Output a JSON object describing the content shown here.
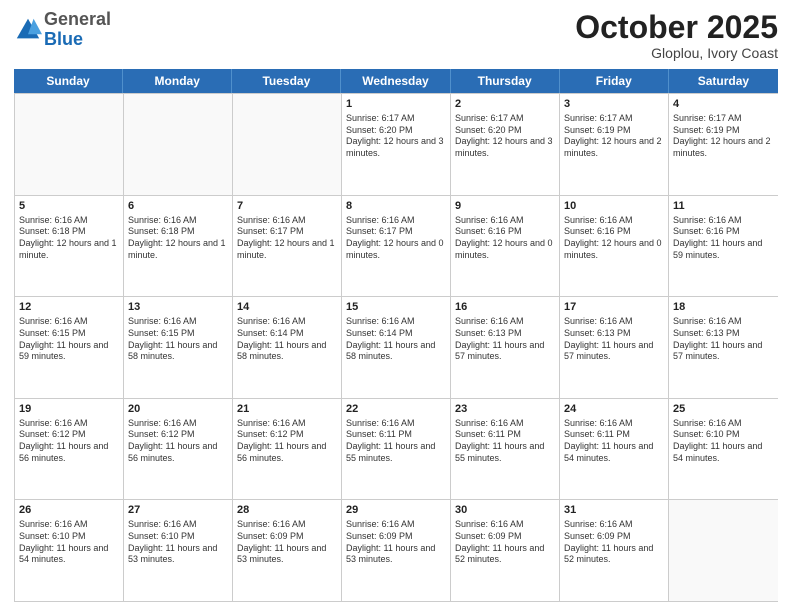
{
  "header": {
    "logo_general": "General",
    "logo_blue": "Blue",
    "month_title": "October 2025",
    "location": "Gloplou, Ivory Coast"
  },
  "days_of_week": [
    "Sunday",
    "Monday",
    "Tuesday",
    "Wednesday",
    "Thursday",
    "Friday",
    "Saturday"
  ],
  "weeks": [
    [
      {
        "day": "",
        "info": ""
      },
      {
        "day": "",
        "info": ""
      },
      {
        "day": "",
        "info": ""
      },
      {
        "day": "1",
        "info": "Sunrise: 6:17 AM\nSunset: 6:20 PM\nDaylight: 12 hours and 3 minutes."
      },
      {
        "day": "2",
        "info": "Sunrise: 6:17 AM\nSunset: 6:20 PM\nDaylight: 12 hours and 3 minutes."
      },
      {
        "day": "3",
        "info": "Sunrise: 6:17 AM\nSunset: 6:19 PM\nDaylight: 12 hours and 2 minutes."
      },
      {
        "day": "4",
        "info": "Sunrise: 6:17 AM\nSunset: 6:19 PM\nDaylight: 12 hours and 2 minutes."
      }
    ],
    [
      {
        "day": "5",
        "info": "Sunrise: 6:16 AM\nSunset: 6:18 PM\nDaylight: 12 hours and 1 minute."
      },
      {
        "day": "6",
        "info": "Sunrise: 6:16 AM\nSunset: 6:18 PM\nDaylight: 12 hours and 1 minute."
      },
      {
        "day": "7",
        "info": "Sunrise: 6:16 AM\nSunset: 6:17 PM\nDaylight: 12 hours and 1 minute."
      },
      {
        "day": "8",
        "info": "Sunrise: 6:16 AM\nSunset: 6:17 PM\nDaylight: 12 hours and 0 minutes."
      },
      {
        "day": "9",
        "info": "Sunrise: 6:16 AM\nSunset: 6:16 PM\nDaylight: 12 hours and 0 minutes."
      },
      {
        "day": "10",
        "info": "Sunrise: 6:16 AM\nSunset: 6:16 PM\nDaylight: 12 hours and 0 minutes."
      },
      {
        "day": "11",
        "info": "Sunrise: 6:16 AM\nSunset: 6:16 PM\nDaylight: 11 hours and 59 minutes."
      }
    ],
    [
      {
        "day": "12",
        "info": "Sunrise: 6:16 AM\nSunset: 6:15 PM\nDaylight: 11 hours and 59 minutes."
      },
      {
        "day": "13",
        "info": "Sunrise: 6:16 AM\nSunset: 6:15 PM\nDaylight: 11 hours and 58 minutes."
      },
      {
        "day": "14",
        "info": "Sunrise: 6:16 AM\nSunset: 6:14 PM\nDaylight: 11 hours and 58 minutes."
      },
      {
        "day": "15",
        "info": "Sunrise: 6:16 AM\nSunset: 6:14 PM\nDaylight: 11 hours and 58 minutes."
      },
      {
        "day": "16",
        "info": "Sunrise: 6:16 AM\nSunset: 6:13 PM\nDaylight: 11 hours and 57 minutes."
      },
      {
        "day": "17",
        "info": "Sunrise: 6:16 AM\nSunset: 6:13 PM\nDaylight: 11 hours and 57 minutes."
      },
      {
        "day": "18",
        "info": "Sunrise: 6:16 AM\nSunset: 6:13 PM\nDaylight: 11 hours and 57 minutes."
      }
    ],
    [
      {
        "day": "19",
        "info": "Sunrise: 6:16 AM\nSunset: 6:12 PM\nDaylight: 11 hours and 56 minutes."
      },
      {
        "day": "20",
        "info": "Sunrise: 6:16 AM\nSunset: 6:12 PM\nDaylight: 11 hours and 56 minutes."
      },
      {
        "day": "21",
        "info": "Sunrise: 6:16 AM\nSunset: 6:12 PM\nDaylight: 11 hours and 56 minutes."
      },
      {
        "day": "22",
        "info": "Sunrise: 6:16 AM\nSunset: 6:11 PM\nDaylight: 11 hours and 55 minutes."
      },
      {
        "day": "23",
        "info": "Sunrise: 6:16 AM\nSunset: 6:11 PM\nDaylight: 11 hours and 55 minutes."
      },
      {
        "day": "24",
        "info": "Sunrise: 6:16 AM\nSunset: 6:11 PM\nDaylight: 11 hours and 54 minutes."
      },
      {
        "day": "25",
        "info": "Sunrise: 6:16 AM\nSunset: 6:10 PM\nDaylight: 11 hours and 54 minutes."
      }
    ],
    [
      {
        "day": "26",
        "info": "Sunrise: 6:16 AM\nSunset: 6:10 PM\nDaylight: 11 hours and 54 minutes."
      },
      {
        "day": "27",
        "info": "Sunrise: 6:16 AM\nSunset: 6:10 PM\nDaylight: 11 hours and 53 minutes."
      },
      {
        "day": "28",
        "info": "Sunrise: 6:16 AM\nSunset: 6:09 PM\nDaylight: 11 hours and 53 minutes."
      },
      {
        "day": "29",
        "info": "Sunrise: 6:16 AM\nSunset: 6:09 PM\nDaylight: 11 hours and 53 minutes."
      },
      {
        "day": "30",
        "info": "Sunrise: 6:16 AM\nSunset: 6:09 PM\nDaylight: 11 hours and 52 minutes."
      },
      {
        "day": "31",
        "info": "Sunrise: 6:16 AM\nSunset: 6:09 PM\nDaylight: 11 hours and 52 minutes."
      },
      {
        "day": "",
        "info": ""
      }
    ]
  ]
}
